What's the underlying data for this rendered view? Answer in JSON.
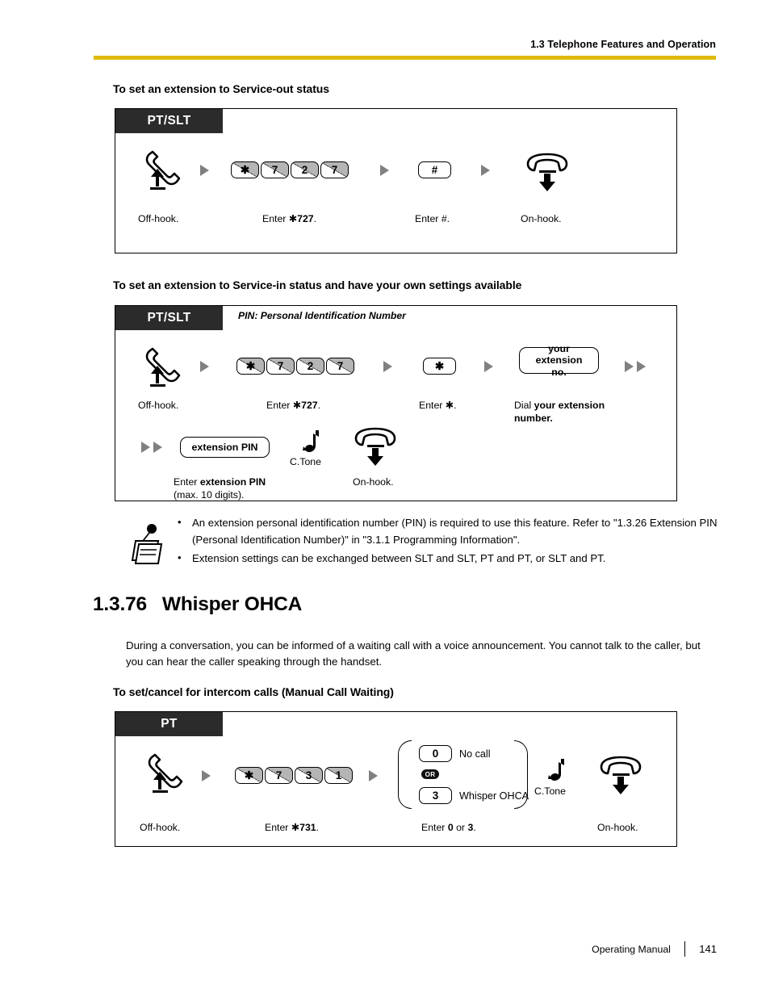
{
  "header": {
    "running_head": "1.3 Telephone Features and Operation",
    "rule_color": "#e0b90a"
  },
  "sections": {
    "service_out": {
      "heading": "To set an extension to Service-out status",
      "phone_type": "PT/SLT",
      "steps": [
        {
          "caption": "Off-hook.",
          "icon": "offhook-handset-icon"
        },
        {
          "caption_prefix": "Enter ",
          "caption_code": "✱727",
          "caption_suffix": ".",
          "keys": [
            "✱",
            "7",
            "2",
            "7"
          ]
        },
        {
          "caption_prefix": "Enter ",
          "caption_code": "#",
          "caption_suffix": ".",
          "keys": [
            "#"
          ]
        },
        {
          "caption": "On-hook.",
          "icon": "onhook-handset-icon"
        }
      ]
    },
    "service_in": {
      "heading": "To set an extension to Service-in status and have your own settings available",
      "phone_type": "PT/SLT",
      "tab_note": "PIN: Personal Identification Number",
      "row1": [
        {
          "caption": "Off-hook.",
          "icon": "offhook-handset-icon"
        },
        {
          "caption_prefix": "Enter ",
          "caption_code": "✱727",
          "caption_suffix": ".",
          "keys": [
            "✱",
            "7",
            "2",
            "7"
          ]
        },
        {
          "caption_prefix": "Enter ",
          "caption_code": "✱",
          "caption_suffix": ".",
          "keys": [
            "✱"
          ]
        },
        {
          "capsule_line1": "your",
          "capsule_line2": "extension no.",
          "caption_prefix": "Dial ",
          "caption_bold": "your extension",
          "caption_bold2": "number."
        }
      ],
      "row2": {
        "capsule": "extension PIN",
        "caption_prefix": "Enter ",
        "caption_bold": "extension PIN",
        "caption_line2": "(max. 10 digits).",
        "ctone_label": "C.Tone",
        "onhook_caption": "On-hook."
      }
    },
    "notes": [
      "An extension personal identification number (PIN) is required to use this feature. Refer to \"1.3.26 Extension PIN (Personal Identification Number)\" in \"3.1.1 Programming Information\".",
      "Extension settings can be exchanged between SLT and SLT, PT and PT, or SLT and PT."
    ],
    "whisper": {
      "number": "1.3.76",
      "title": "Whisper OHCA",
      "body": "During a conversation, you can be informed of a waiting call with a voice announcement. You cannot talk to the caller, but you can hear the caller speaking through the handset.",
      "heading": "To set/cancel for intercom calls (Manual Call Waiting)",
      "phone_type": "PT",
      "steps": [
        {
          "caption": "Off-hook.",
          "icon": "offhook-handset-icon"
        },
        {
          "caption_prefix": "Enter  ",
          "caption_code": "✱731",
          "caption_suffix": ".",
          "keys": [
            "✱",
            "7",
            "3",
            "1"
          ]
        },
        {
          "caption_prefix": "Enter ",
          "caption_opt1": "0",
          "caption_mid": " or ",
          "caption_opt2": "3",
          "caption_suffix": ".",
          "options": [
            {
              "key": "0",
              "label": "No call"
            },
            {
              "key": "3",
              "label": "Whisper OHCA"
            }
          ],
          "or_badge": "OR"
        },
        {
          "ctone_label": "C.Tone",
          "icon": "ctone-icon"
        },
        {
          "caption": "On-hook.",
          "icon": "onhook-handset-icon"
        }
      ]
    }
  },
  "footer": {
    "manual": "Operating Manual",
    "page": "141"
  }
}
